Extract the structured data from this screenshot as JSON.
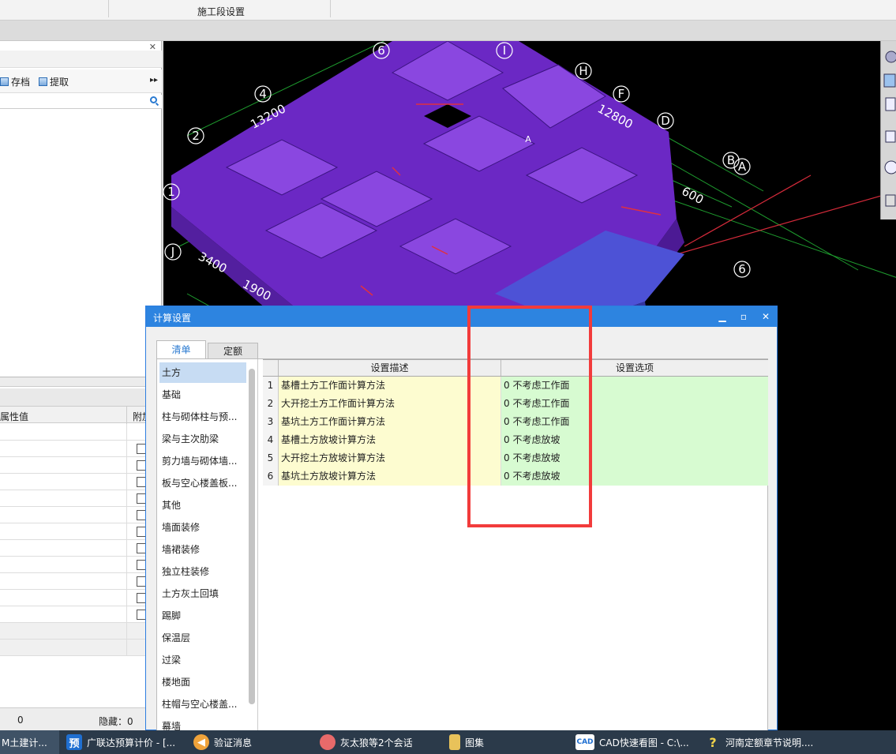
{
  "topbar": {
    "title": "施工段设置"
  },
  "left_panel": {
    "toolbar": {
      "save_label": "存档",
      "fetch_label": "提取"
    },
    "props": {
      "col_value": "属性值",
      "col_extra": "附加"
    },
    "status": {
      "count": "0",
      "hidden": "隐藏：0"
    }
  },
  "viewport": {
    "axis_labels": [
      "6",
      "I",
      "H",
      "F",
      "D",
      "B",
      "A",
      "4",
      "2",
      "1",
      "J",
      "6",
      "A"
    ],
    "dims": [
      "13200",
      "12800",
      "3400",
      "1900",
      "600"
    ]
  },
  "dialog": {
    "title": "计算设置",
    "tabs": {
      "list": "清单",
      "quota": "定额"
    },
    "categories": [
      "土方",
      "基础",
      "柱与砌体柱与预...",
      "梁与主次肋梁",
      "剪力墙与砌体墙...",
      "板与空心楼盖板...",
      "其他",
      "墙面装修",
      "墙裙装修",
      "独立柱装修",
      "土方灰土回填",
      "踢脚",
      "保温层",
      "过梁",
      "楼地面",
      "柱帽与空心楼盖...",
      "幕墙"
    ],
    "grid": {
      "col_desc": "设置描述",
      "col_opt": "设置选项",
      "rows": [
        {
          "num": "1",
          "desc": "基槽土方工作面计算方法",
          "opt": "0 不考虑工作面"
        },
        {
          "num": "2",
          "desc": "大开挖土方工作面计算方法",
          "opt": "0 不考虑工作面"
        },
        {
          "num": "3",
          "desc": "基坑土方工作面计算方法",
          "opt": "0 不考虑工作面"
        },
        {
          "num": "4",
          "desc": "基槽土方放坡计算方法",
          "opt": "0 不考虑放坡"
        },
        {
          "num": "5",
          "desc": "大开挖土方放坡计算方法",
          "opt": "0 不考虑放坡"
        },
        {
          "num": "6",
          "desc": "基坑土方放坡计算方法",
          "opt": "0 不考虑放坡"
        }
      ]
    }
  },
  "taskbar": {
    "items": [
      "M土建计...",
      "广联达预算计价 - [...",
      "验证消息",
      "灰太狼等2个会话",
      "图集",
      "CAD快速看图 - C:\\...",
      "河南定额章节说明...."
    ],
    "icon_glyphs": {
      "budget": "预",
      "cad": "CAD"
    }
  },
  "colors": {
    "accent": "#2d84e0",
    "highlight": "#f23b3b",
    "desc_bg": "#fdfcd0",
    "opt_bg": "#d7fbd1",
    "model": "#6f2bc4"
  }
}
